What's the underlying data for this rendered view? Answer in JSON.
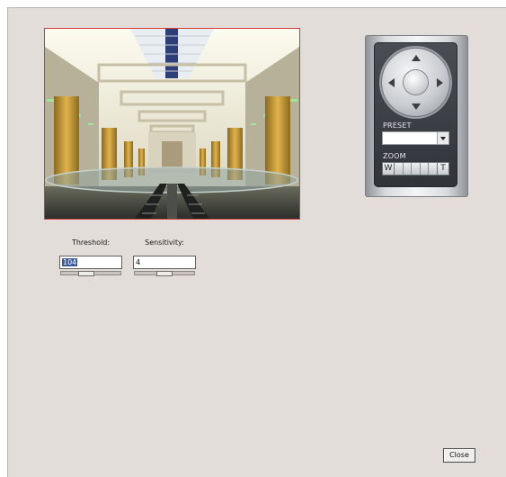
{
  "camera_view": {
    "image_subject": "mall-atrium-interior"
  },
  "ptz": {
    "preset_label": "PRESET",
    "preset_value": "",
    "zoom_label": "ZOOM",
    "zoom_wide": "W",
    "zoom_tele": "T",
    "icons": [
      "pan-up-icon",
      "pan-down-icon",
      "pan-left-icon",
      "pan-right-icon",
      "home-icon",
      "dropdown-arrow-icon"
    ]
  },
  "threshold": {
    "label": "Threshold:",
    "value": "104",
    "level": 0.4
  },
  "sensitivity": {
    "label": "Sensitivity:",
    "value": "4",
    "level": 0.5
  },
  "close_label": "Close",
  "colors": {
    "camera_border": "#d03a3a",
    "window_bg": "#e2ddd8",
    "selection": "#3c5a9b"
  }
}
